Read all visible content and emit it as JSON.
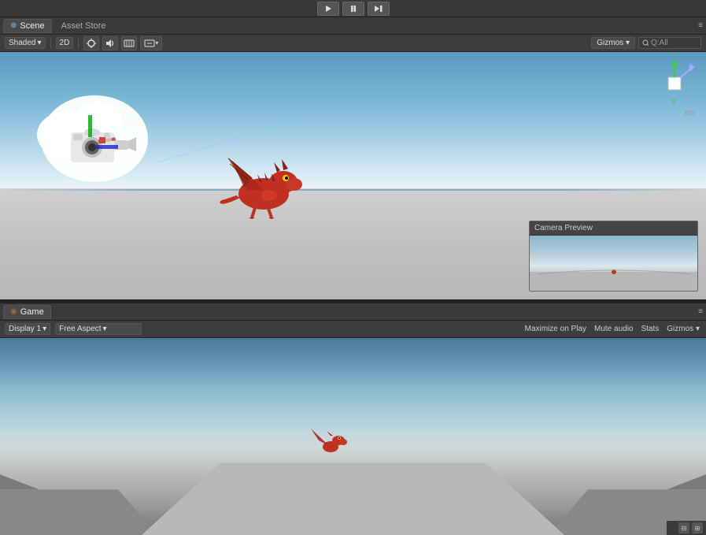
{
  "toolbar": {
    "play_label": "▶",
    "pause_label": "⏸",
    "step_label": "⏭"
  },
  "scene_panel": {
    "tab_scene_label": "Scene",
    "tab_asset_store_label": "Asset Store",
    "scene_icon": "⊕",
    "shading_label": "Shaded",
    "mode_2d_label": "2D",
    "gizmos_label": "Gizmos",
    "search_placeholder": "Q:All",
    "iso_label": "Iso",
    "camera_preview_title": "Camera Preview"
  },
  "game_panel": {
    "tab_game_label": "Game",
    "game_icon": "◉",
    "display_label": "Display 1",
    "aspect_label": "Free Aspect",
    "maximize_label": "Maximize on Play",
    "mute_label": "Mute audio",
    "stats_label": "Stats",
    "gizmos_label": "Gizmos"
  },
  "colors": {
    "accent": "#4a9aca",
    "bg_dark": "#2a2a2a",
    "bg_mid": "#3c3c3c",
    "bg_light": "#4a4a4a",
    "border": "#555555"
  }
}
